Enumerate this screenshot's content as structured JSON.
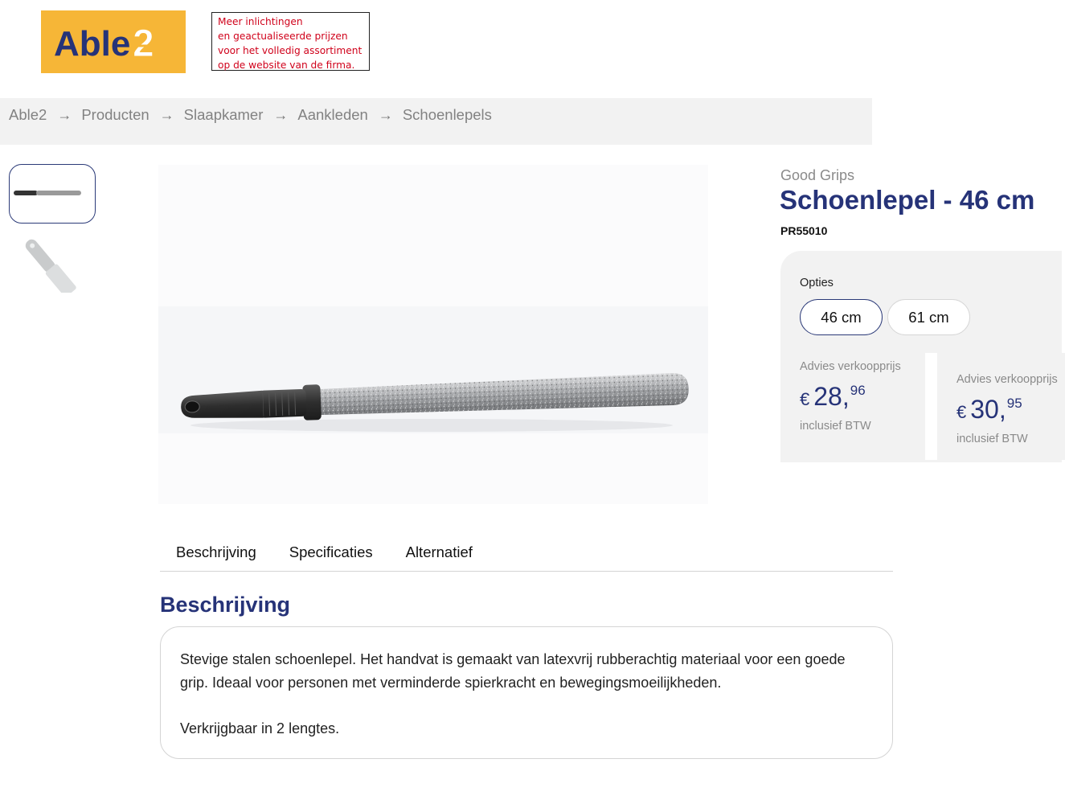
{
  "logo": {
    "text": "Able2",
    "icon": "able2-logo",
    "bg_color": "#f6b637",
    "text_color": "#263378"
  },
  "notice": {
    "lines": [
      "Meer inlichtingen",
      "en geactualiseerde prijzen",
      "voor het volledig assortiment",
      "op de website van de firma."
    ],
    "color": "#d0021b"
  },
  "breadcrumb": {
    "items": [
      "Able2",
      "Producten",
      "Slaapkamer",
      "Aankleden",
      "Schoenlepels"
    ],
    "separator": "→"
  },
  "gallery": {
    "thumbnails": [
      {
        "icon": "shoehorn-thumbnail-horizontal",
        "selected": true
      },
      {
        "icon": "shoehorn-thumbnail-angled",
        "selected": false
      }
    ],
    "main_image_icon": "shoehorn-product-image"
  },
  "product": {
    "brand": "Good Grips",
    "title": "Schoenlepel - 46 cm",
    "sku": "PR55010",
    "accent_color": "#263378"
  },
  "options": {
    "label": "Opties",
    "items": [
      {
        "label": "46 cm",
        "selected": true
      },
      {
        "label": "61 cm",
        "selected": false
      }
    ]
  },
  "prices": [
    {
      "label": "Advies verkoopprijs",
      "currency": "€",
      "whole": "28,",
      "cents": "96",
      "vat": "inclusief BTW"
    },
    {
      "label": "Advies verkoopprijs",
      "currency": "€",
      "whole": "30,",
      "cents": "95",
      "vat": "inclusief BTW"
    }
  ],
  "tabs": [
    "Beschrijving",
    "Specificaties",
    "Alternatief"
  ],
  "description": {
    "title": "Beschrijving",
    "paragraphs": [
      "Stevige stalen schoenlepel. Het handvat is gemaakt van latexvrij rubberachtig materiaal voor een goede grip. Ideaal voor personen met verminderde spierkracht en bewegingsmoeilijkheden.",
      "Verkrijgbaar in 2 lengtes."
    ]
  }
}
